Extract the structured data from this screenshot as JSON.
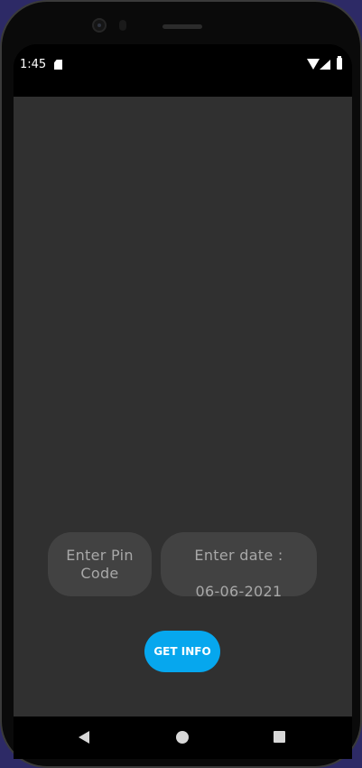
{
  "status_bar": {
    "time": "1:45",
    "icons": [
      "sd-card-icon",
      "wifi-icon",
      "signal-icon",
      "battery-icon"
    ]
  },
  "form": {
    "pin_code": {
      "placeholder": "Enter Pin Code",
      "value": ""
    },
    "date": {
      "label": "Enter date :",
      "value": "06-06-2021"
    },
    "submit_label": "GET INFO"
  },
  "navigation": {
    "icons": [
      "back-icon",
      "home-icon",
      "recents-icon"
    ]
  },
  "colors": {
    "background": "#303030",
    "field_background": "#424242",
    "field_text": "#a8a8a8",
    "accent": "#06a7ee"
  }
}
